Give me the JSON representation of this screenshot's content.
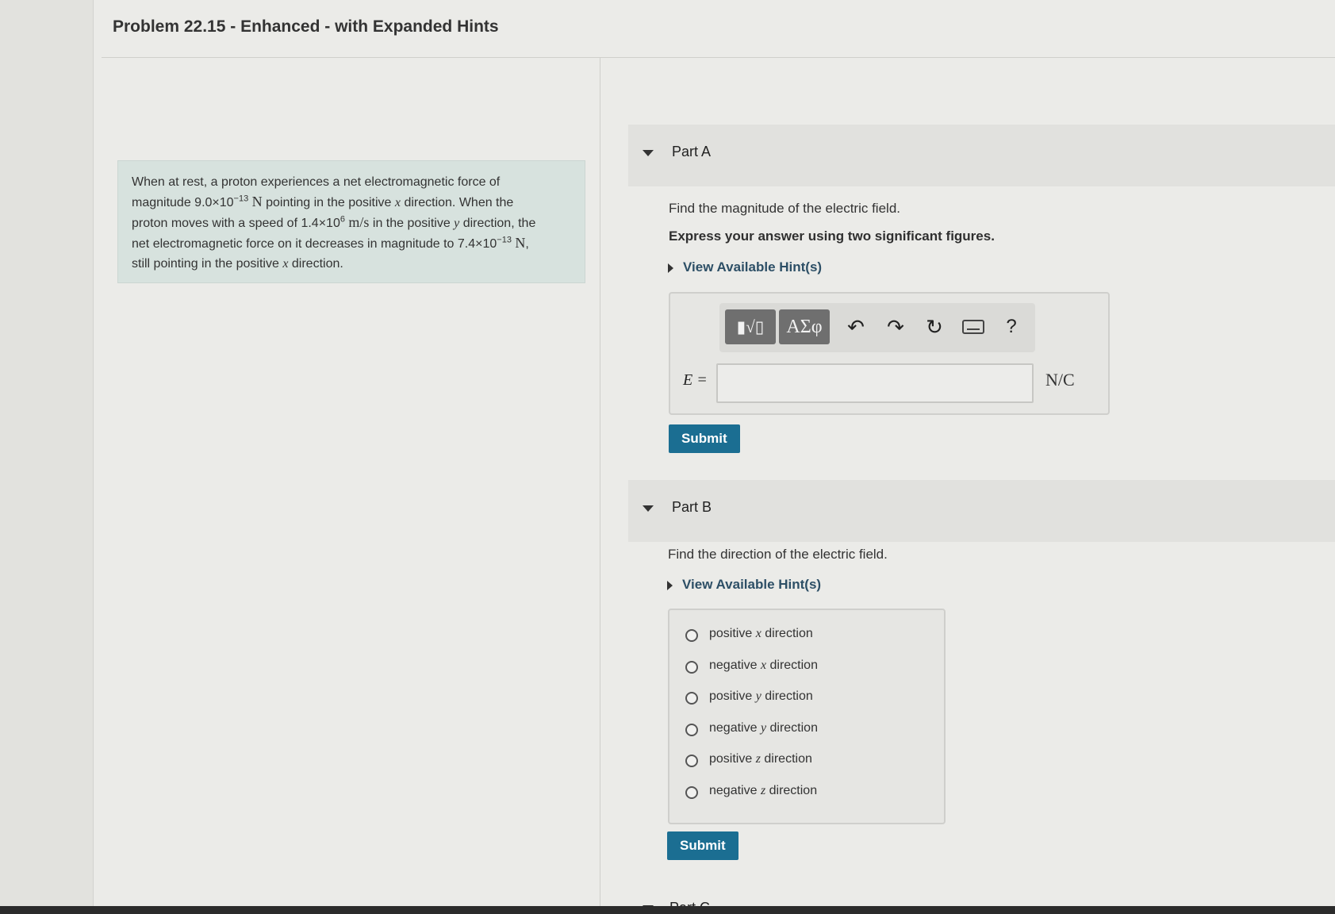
{
  "header": {
    "title": "Problem 22.15 - Enhanced - with Expanded Hints"
  },
  "problem": {
    "line1": "When at rest, a proton experiences a net electromagnetic force of",
    "line2_a": "magnitude 9.0×10",
    "line2_exp": "−13",
    "line2_unit": "N",
    "line2_b": " pointing in the positive ",
    "line2_var": "x",
    "line2_c": " direction. When the",
    "line3_a": "proton moves with a speed of 1.4×10",
    "line3_exp": "6",
    "line3_unit": "m/s",
    "line3_b": " in the positive ",
    "line3_var": "y",
    "line3_c": " direction, the",
    "line4_a": "net electromagnetic force on it decreases in magnitude to 7.4×10",
    "line4_exp": "−13",
    "line4_unit": "N",
    "line4_c": ",",
    "line5_a": "still pointing in the positive ",
    "line5_var": "x",
    "line5_b": " direction."
  },
  "partA": {
    "label": "Part A",
    "question": "Find the magnitude of the electric field.",
    "instruction": "Express your answer using two significant figures.",
    "hint_link": "View Available Hint(s)",
    "toolbar": {
      "templates_label": "▮√▯",
      "symbols_label": "ΑΣφ",
      "help_label": "?"
    },
    "variable_label": "E =",
    "answer_value": "",
    "unit": "N/C",
    "submit_label": "Submit"
  },
  "partB": {
    "label": "Part B",
    "question": "Find the direction of the electric field.",
    "hint_link": "View Available Hint(s)",
    "options": [
      {
        "pre": "positive ",
        "var": "x",
        "post": " direction"
      },
      {
        "pre": "negative ",
        "var": "x",
        "post": " direction"
      },
      {
        "pre": "positive ",
        "var": "y",
        "post": " direction"
      },
      {
        "pre": "negative ",
        "var": "y",
        "post": " direction"
      },
      {
        "pre": "positive ",
        "var": "z",
        "post": " direction"
      },
      {
        "pre": "negative ",
        "var": "z",
        "post": " direction"
      }
    ],
    "submit_label": "Submit"
  },
  "partC": {
    "label": "Part C"
  }
}
